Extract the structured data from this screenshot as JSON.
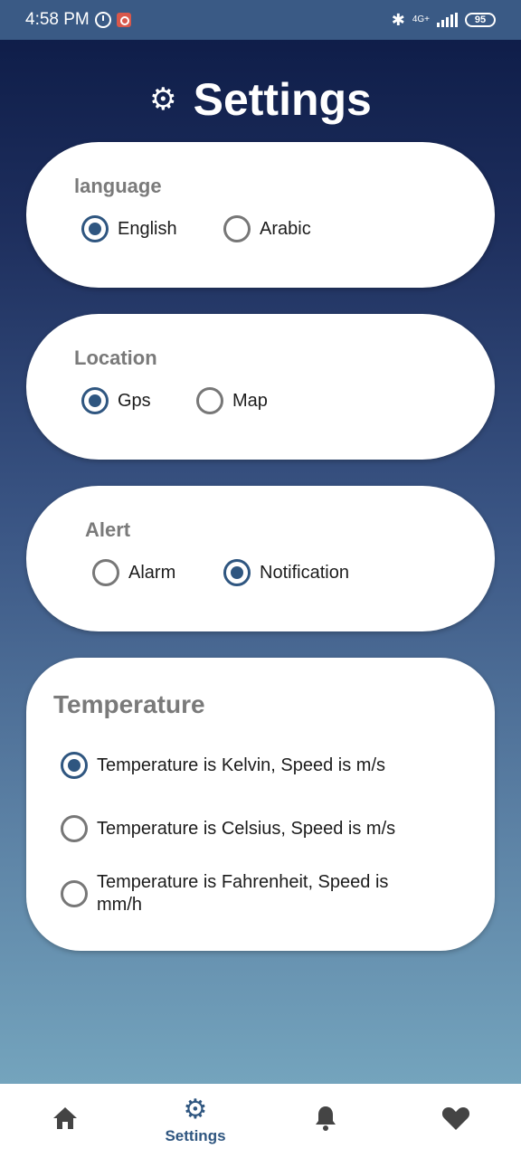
{
  "status_bar": {
    "time": "4:58 PM",
    "network": "4G+",
    "battery": "95"
  },
  "header": {
    "title": "Settings",
    "icon": "gear-icon"
  },
  "language": {
    "title": "language",
    "options": [
      {
        "label": "English",
        "checked": true
      },
      {
        "label": "Arabic",
        "checked": false
      }
    ]
  },
  "location": {
    "title": "Location",
    "options": [
      {
        "label": "Gps",
        "checked": true
      },
      {
        "label": "Map",
        "checked": false
      }
    ]
  },
  "alert": {
    "title": "Alert",
    "options": [
      {
        "label": "Alarm",
        "checked": false
      },
      {
        "label": "Notification",
        "checked": true
      }
    ]
  },
  "temperature": {
    "title": "Temperature",
    "options": [
      {
        "label": "Temperature is Kelvin, Speed is m/s",
        "checked": true
      },
      {
        "label": "Temperature is Celsius, Speed is m/s",
        "checked": false
      },
      {
        "label": "Temperature is Fahrenheit, Speed is mm/h",
        "checked": false
      }
    ]
  },
  "bottom_nav": {
    "items": [
      {
        "icon": "home-icon",
        "label": ""
      },
      {
        "icon": "gear-icon",
        "label": "Settings"
      },
      {
        "icon": "bell-icon",
        "label": ""
      },
      {
        "icon": "heart-icon",
        "label": ""
      }
    ]
  },
  "colors": {
    "accent": "#2f5680",
    "status_bar": "#3a5a85"
  }
}
